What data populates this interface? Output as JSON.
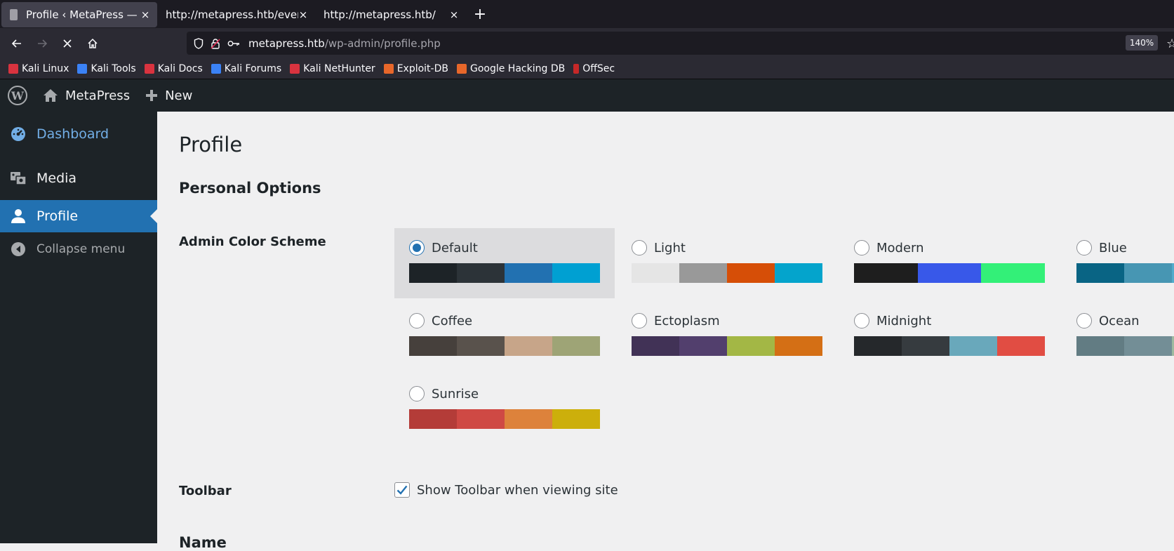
{
  "browser": {
    "tabs": [
      {
        "title": "Profile ‹ MetaPress — Wo",
        "close": "×",
        "active": true
      },
      {
        "title": "http://metapress.htb/events/",
        "close": "×",
        "active": false
      },
      {
        "title": "http://metapress.htb/",
        "close": "×",
        "active": false
      }
    ],
    "new_tab": "+",
    "url_host": "metapress.htb",
    "url_path": "/wp-admin/profile.php",
    "zoom": "140%",
    "bookmarks": [
      {
        "label": "Kali Linux",
        "color": "#d9333f"
      },
      {
        "label": "Kali Tools",
        "color": "#3b82f6"
      },
      {
        "label": "Kali Docs",
        "color": "#d9333f"
      },
      {
        "label": "Kali Forums",
        "color": "#3b82f6"
      },
      {
        "label": "Kali NetHunter",
        "color": "#d9333f"
      },
      {
        "label": "Exploit-DB",
        "color": "#e8672a"
      },
      {
        "label": "Google Hacking DB",
        "color": "#e8672a"
      },
      {
        "label": "OffSec",
        "color": "#c62828"
      }
    ]
  },
  "adminbar": {
    "logo": "W",
    "site_name": "MetaPress",
    "new_label": "New"
  },
  "sidebar": {
    "items": [
      {
        "label": "Dashboard",
        "icon": "dashboard-icon"
      },
      {
        "label": "Media",
        "icon": "media-icon"
      },
      {
        "label": "Profile",
        "icon": "user-icon"
      },
      {
        "label": "Collapse menu",
        "icon": "collapse-icon"
      }
    ]
  },
  "main": {
    "page_title": "Profile",
    "section_title": "Personal Options",
    "color_scheme_label": "Admin Color Scheme",
    "schemes": [
      {
        "name": "Default",
        "selected": true,
        "colors": [
          "#1d2327",
          "#2c3338",
          "#2271b1",
          "#72aee6"
        ]
      },
      {
        "name": "Light",
        "selected": false,
        "colors": [
          "#e5e5e5",
          "#999999",
          "#d64e07",
          "#04a4cc"
        ]
      },
      {
        "name": "Modern",
        "selected": false,
        "colors": [
          "#1e1e1e",
          "#3858e9",
          "#33f078"
        ]
      },
      {
        "name": "Blue",
        "selected": false,
        "colors": [
          "#096484",
          "#4796b3",
          "#52accc",
          "#74b6ce"
        ]
      },
      {
        "name": "Coffee",
        "selected": false,
        "colors": [
          "#46403c",
          "#59524c",
          "#c7a589",
          "#9ea476"
        ]
      },
      {
        "name": "Ectoplasm",
        "selected": false,
        "colors": [
          "#413256",
          "#523f6d",
          "#a3b745",
          "#d46f15"
        ]
      },
      {
        "name": "Midnight",
        "selected": false,
        "colors": [
          "#25282b",
          "#363b3f",
          "#69a8bb",
          "#e14d43"
        ]
      },
      {
        "name": "Ocean",
        "selected": false,
        "colors": [
          "#627c83",
          "#738e96",
          "#9ebaa0",
          "#aa9d88"
        ]
      },
      {
        "name": "Sunrise",
        "selected": false,
        "colors": [
          "#b43c38",
          "#cf4944",
          "#dd823b",
          "#ccaf0b"
        ]
      }
    ],
    "toolbar_label": "Toolbar",
    "toolbar_checkbox": "Show Toolbar when viewing site",
    "toolbar_checked": true,
    "next_section": "Name"
  }
}
